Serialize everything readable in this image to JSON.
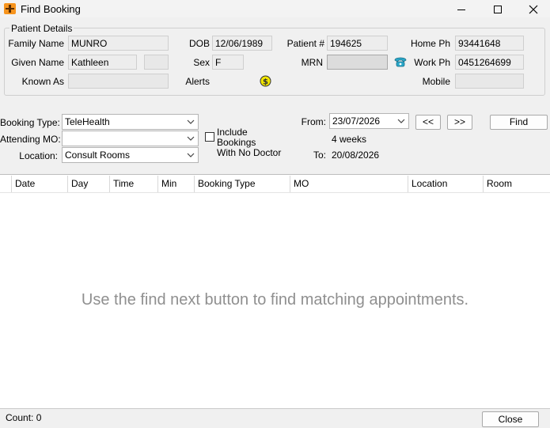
{
  "window": {
    "title": "Find Booking"
  },
  "patient": {
    "group_label": "Patient Details",
    "family_name_label": "Family Name",
    "family_name": "MUNRO",
    "given_name_label": "Given Name",
    "given_name": "Kathleen",
    "known_as_label": "Known As",
    "known_as": "",
    "dob_label": "DOB",
    "dob": "12/06/1989",
    "sex_label": "Sex",
    "sex": "F",
    "alerts_label": "Alerts",
    "patient_no_label": "Patient #",
    "patient_no": "194625",
    "mrn_label": "MRN",
    "mrn": "",
    "home_ph_label": "Home Ph",
    "home_ph": "93441648",
    "work_ph_label": "Work Ph",
    "work_ph": "0451264699",
    "mobile_label": "Mobile",
    "mobile": ""
  },
  "search": {
    "booking_type_label": "Booking Type:",
    "booking_type": "TeleHealth",
    "attending_mo_label": "Attending MO:",
    "attending_mo": "",
    "location_label": "Location:",
    "location": "Consult Rooms",
    "include_no_doctor_line1": "Include Bookings",
    "include_no_doctor_line2": "With No Doctor",
    "include_no_doctor_checked": false,
    "from_label": "From:",
    "from_date": "23/07/2026",
    "duration": "4 weeks",
    "to_label": "To:",
    "to_date": "20/08/2026",
    "prev_label": "<<",
    "next_label": ">>",
    "find_label": "Find"
  },
  "table": {
    "columns": [
      "Date",
      "Day",
      "Time",
      "Min",
      "Booking Type",
      "MO",
      "Location",
      "Room"
    ],
    "empty_message": "Use the find next button to find matching appointments."
  },
  "status": {
    "count_text": "Count: 0",
    "close_label": "Close"
  },
  "colors": {
    "alert_icon": "#f2e600",
    "phone_icon": "#2aa7c9",
    "app_icon": "#f7941d"
  },
  "icons": {
    "app": "booking-app-icon",
    "alert": "dollar-alert-icon",
    "phone": "phone-icon"
  }
}
